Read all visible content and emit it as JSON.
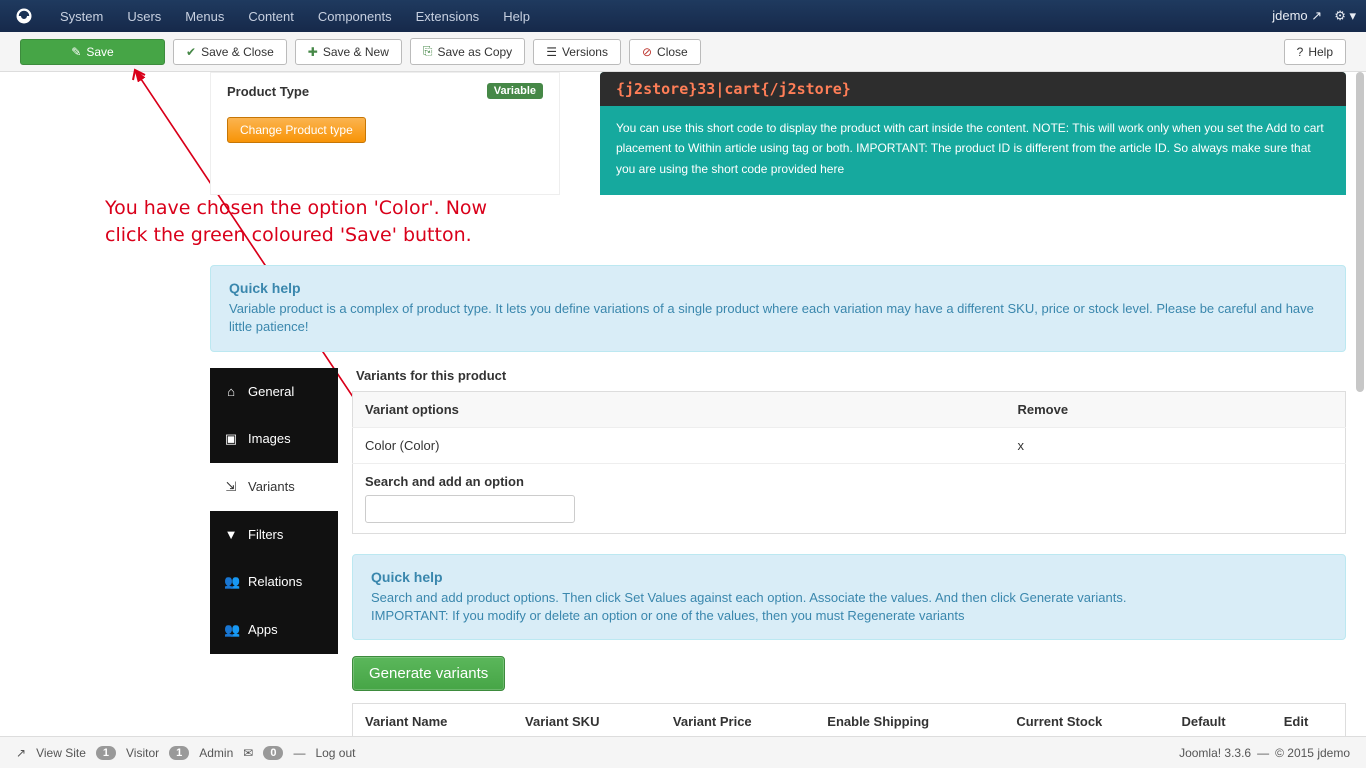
{
  "navbar": {
    "items": [
      "System",
      "Users",
      "Menus",
      "Content",
      "Components",
      "Extensions",
      "Help"
    ],
    "user": "jdemo"
  },
  "toolbar": {
    "save": "Save",
    "save_close": "Save & Close",
    "save_new": "Save & New",
    "save_copy": "Save as Copy",
    "versions": "Versions",
    "close": "Close",
    "help": "Help"
  },
  "product_type": {
    "label": "Product Type",
    "value": "Variable",
    "change_btn": "Change Product type"
  },
  "shortcode": {
    "code": "{j2store}33|cart{/j2store}",
    "desc": "You can use this short code to display the product with cart inside the content. NOTE: This will work only when you set the Add to cart placement to Within article using tag or both. IMPORTANT: The product ID is different from the article ID. So always make sure that you are using the short code provided here"
  },
  "annotation": {
    "line1": "You have chosen the option 'Color'. Now",
    "line2": "click the green coloured 'Save' button."
  },
  "quickhelp1": {
    "title": "Quick help",
    "body": "Variable product is a complex of product type. It lets you define variations of a single product where each variation may have a different SKU, price or stock level. Please be careful and have little patience!"
  },
  "tabs": {
    "general": "General",
    "images": "Images",
    "variants": "Variants",
    "filters": "Filters",
    "relations": "Relations",
    "apps": "Apps"
  },
  "variants": {
    "heading": "Variants for this product",
    "col_options": "Variant options",
    "col_remove": "Remove",
    "row_option": "Color (Color)",
    "row_remove": "x",
    "search_label": "Search and add an option",
    "generate_btn": "Generate variants",
    "list_cols": {
      "name": "Variant Name",
      "sku": "Variant SKU",
      "price": "Variant Price",
      "shipping": "Enable Shipping",
      "stock": "Current Stock",
      "default": "Default",
      "edit": "Edit"
    }
  },
  "quickhelp2": {
    "title": "Quick help",
    "body1": "Search and add product options. Then click Set Values against each option. Associate the values. And then click Generate variants.",
    "body2": "IMPORTANT: If you modify or delete an option or one of the values, then you must Regenerate variants"
  },
  "statusbar": {
    "view_site": "View Site",
    "visitor_count": "1",
    "visitor": "Visitor",
    "admin_count": "1",
    "admin": "Admin",
    "msg_count": "0",
    "logout": "Log out",
    "version": "Joomla! 3.3.6",
    "copyright": "© 2015 jdemo"
  }
}
